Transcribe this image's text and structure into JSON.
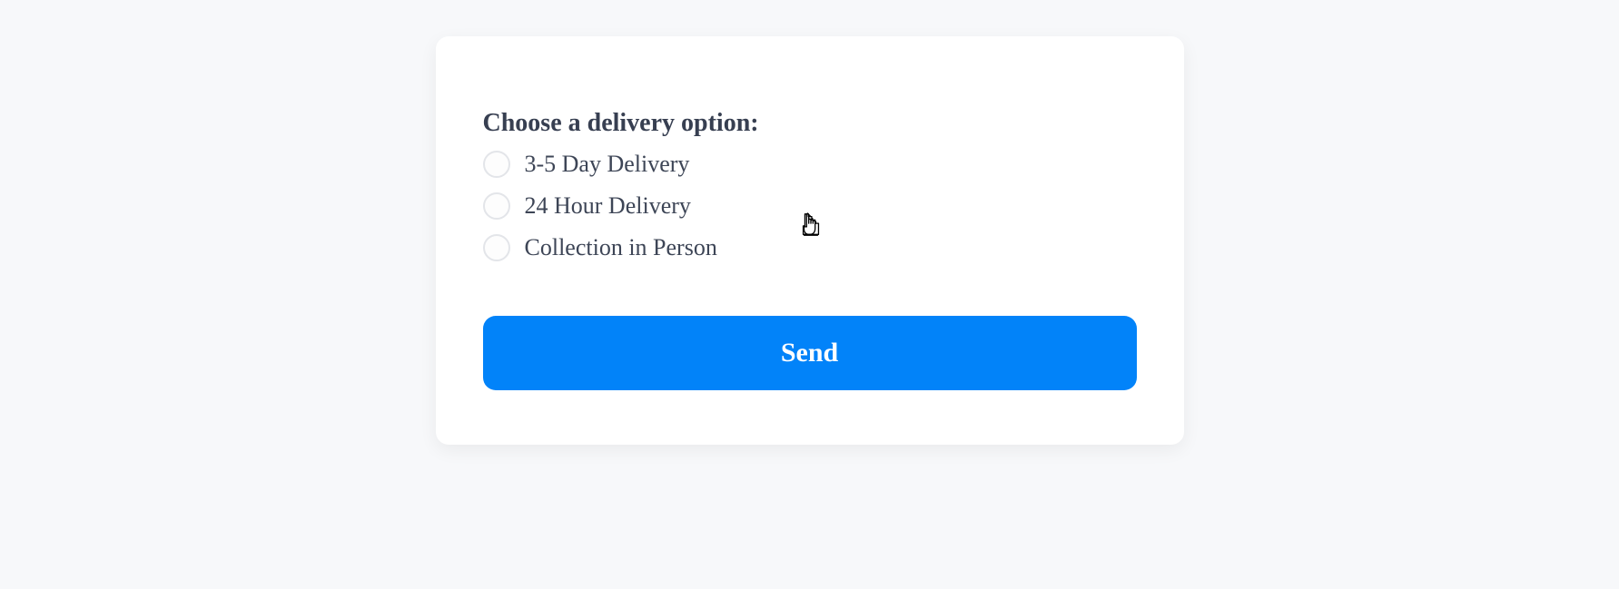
{
  "form": {
    "title": "Choose a delivery option:",
    "options": [
      {
        "label": "3-5 Day Delivery"
      },
      {
        "label": "24 Hour Delivery"
      },
      {
        "label": "Collection in Person"
      }
    ],
    "submit_label": "Send"
  }
}
